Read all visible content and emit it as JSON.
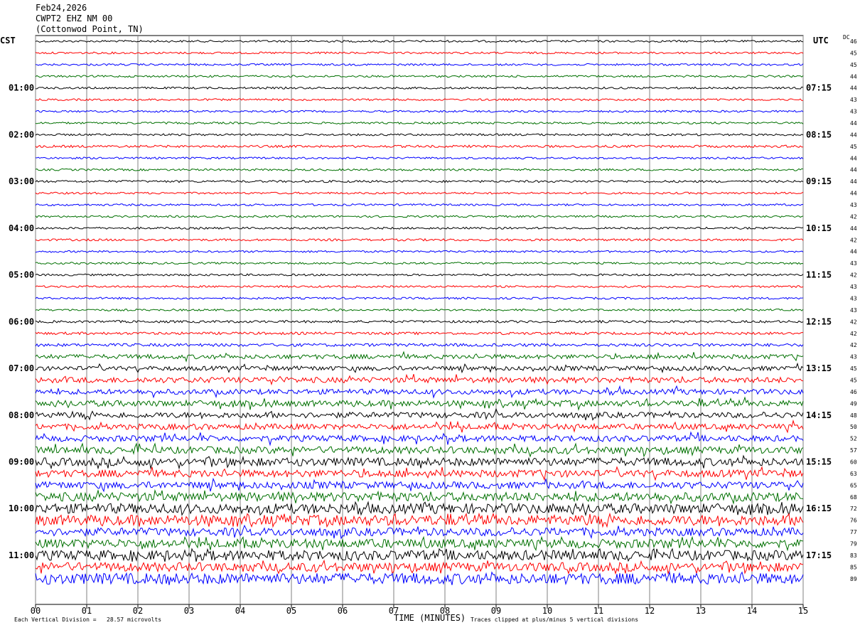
{
  "header": {
    "date": "Feb24,2026",
    "station": "CWPT2 EHZ NM 00",
    "location": "(Cottonwod Point, TN)"
  },
  "left_tz": "CST",
  "right_tz": "UTC",
  "dc_label": "DC",
  "footer": {
    "scale_note": "Each Vertical Division =   28.57 microvolts",
    "xlabel": "TIME (MINUTES)",
    "clip_note": "Traces clipped at plus/minus 5 vertical divisions"
  },
  "chart_data": {
    "type": "line",
    "title": "",
    "xlabel": "TIME (MINUTES)",
    "ylabel": "",
    "x_ticks": [
      "00",
      "01",
      "02",
      "03",
      "04",
      "05",
      "06",
      "07",
      "08",
      "09",
      "10",
      "11",
      "12",
      "13",
      "14",
      "15"
    ],
    "xlim": [
      0,
      15
    ],
    "trace_colors": [
      "#000000",
      "#ff0000",
      "#0000ff",
      "#007000"
    ],
    "left_hour_labels": [
      "01:00",
      "02:00",
      "03:00",
      "04:00",
      "05:00",
      "06:00",
      "07:00",
      "08:00",
      "09:00",
      "10:00",
      "11:00"
    ],
    "right_hour_labels": [
      "07:15",
      "08:15",
      "09:15",
      "10:15",
      "11:15",
      "12:15",
      "13:15",
      "14:15",
      "15:15",
      "16:15",
      "17:15"
    ],
    "dc_offsets": [
      46,
      45,
      45,
      44,
      44,
      43,
      43,
      44,
      44,
      45,
      44,
      44,
      44,
      44,
      43,
      42,
      44,
      42,
      44,
      43,
      42,
      43,
      43,
      43,
      42,
      42,
      42,
      43,
      45,
      45,
      46,
      49,
      48,
      50,
      52,
      57,
      60,
      63,
      65,
      68,
      72,
      76,
      77,
      79,
      83,
      85,
      89
    ],
    "trace_amplitude": [
      1,
      1,
      1,
      1,
      1,
      1,
      1,
      1,
      1,
      1.2,
      1,
      1,
      1.1,
      1,
      1,
      1,
      1,
      1.1,
      1,
      1,
      1,
      1,
      1,
      1,
      1.2,
      1.3,
      1.5,
      2.2,
      2.2,
      2.8,
      2.6,
      3,
      2.8,
      2.8,
      3,
      3.5,
      4,
      3.6,
      3.4,
      4.5,
      5,
      5.2,
      4,
      4.5,
      5,
      4.5,
      5.5
    ]
  }
}
